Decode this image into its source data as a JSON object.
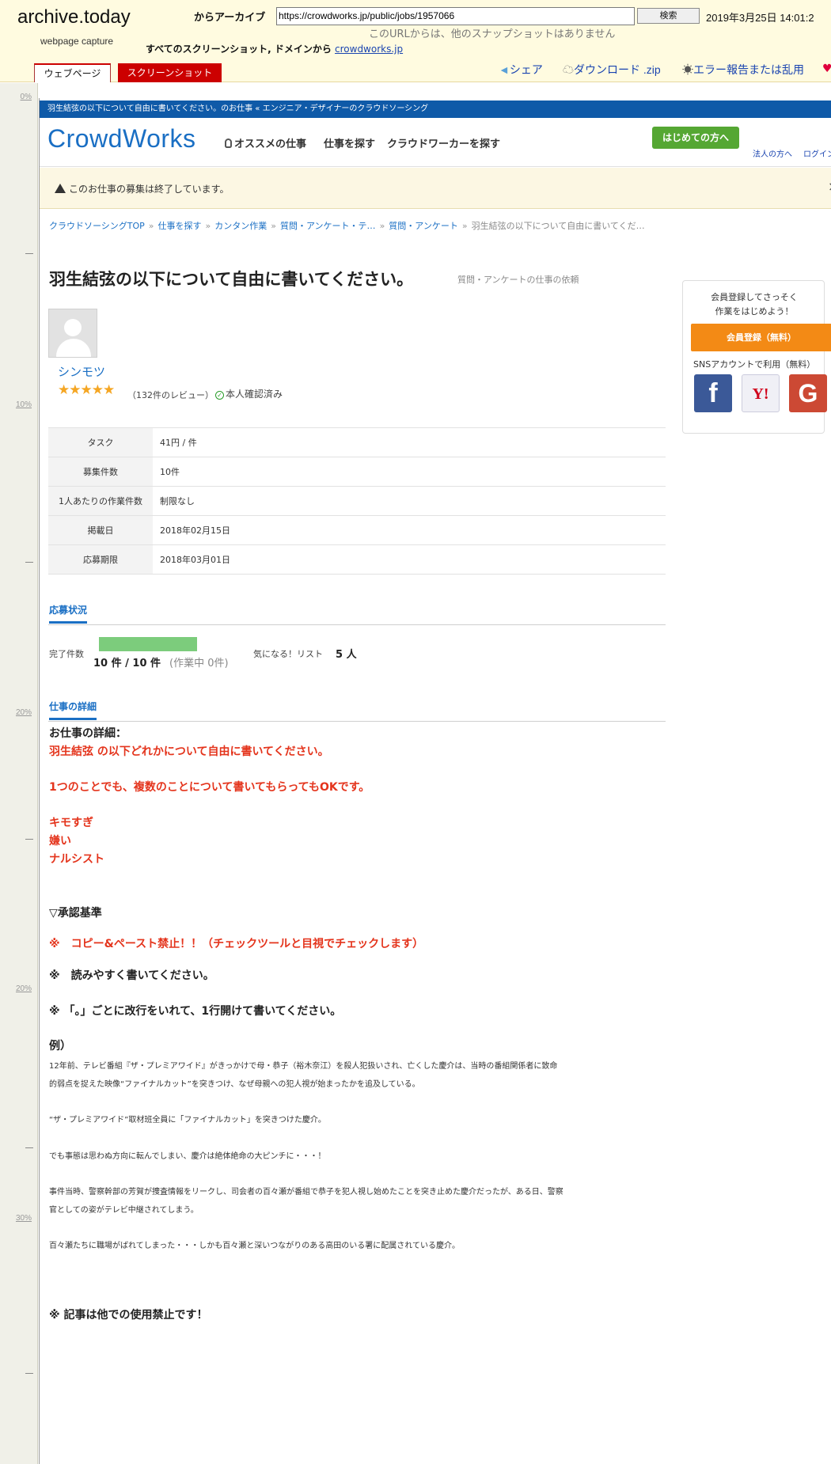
{
  "archive": {
    "logo": "archive.today",
    "subtitle": "webpage capture",
    "from_label": "からアーカイブ",
    "url": "https://crowdworks.jp/public/jobs/1957066",
    "search_button": "検索",
    "date": "2019年3月25日 14:01:2",
    "no_snapshot_text": "このURLからは、他のスナップショットはありません",
    "all_screenshots_text": "すべてのスクリーンショット, ドメインから",
    "domain_link": "crowdworks.jp",
    "tabs": {
      "webpage": "ウェブページ",
      "screenshot": "スクリーンショット"
    },
    "actions": {
      "share": "シェア",
      "download": "ダウンロード .zip",
      "report": "エラー報告または乱用"
    },
    "icons": {
      "share": "share-icon",
      "download": "cloud-download-icon",
      "report": "bug-icon",
      "heart": "heart-icon"
    }
  },
  "ruler": {
    "labels": [
      "0%",
      "10%",
      "20%",
      "20%",
      "30%"
    ]
  },
  "site": {
    "top_strip": "羽生結弦の以下について自由に書いてください。のお仕事 « エンジニア・デザイナーのクラウドソーシング",
    "logo": "CrowdWorks",
    "nav": {
      "recommend": "オススメの仕事",
      "find_job": "仕事を探す",
      "find_worker": "クラウドワーカーを探す",
      "beginners": "はじめての方へ",
      "corporate": "法人の方へ",
      "login": "ログイン"
    },
    "closed_notice": "このお仕事の募集は終了しています。",
    "breadcrumb": [
      "クラウドソーシングTOP",
      "仕事を探す",
      "カンタン作業",
      "質問・アンケート・テ…",
      "質問・アンケート",
      "羽生結弦の以下について自由に書いてくだ…"
    ],
    "breadcrumb_sep": "»",
    "brand_color": "#1a6fc4",
    "accent_red": "#e4341c"
  },
  "job": {
    "title": "羽生結弦の以下について自由に書いてください。",
    "category": "質問・アンケートの仕事の依頼",
    "client": {
      "name": "シンモツ",
      "stars": "★★★★★",
      "rating": 5,
      "reviews": "（132件のレビュー）",
      "verified": "本人確認済み"
    },
    "info_table": [
      {
        "label": "タスク",
        "value": "41円 / 件"
      },
      {
        "label": "募集件数",
        "value": "10件"
      },
      {
        "label": "1人あたりの作業件数",
        "value": "制限なし"
      },
      {
        "label": "掲載日",
        "value": "2018年02月15日"
      },
      {
        "label": "応募期限",
        "value": "2018年03月01日"
      }
    ],
    "status": {
      "section_title": "応募状況",
      "done_label": "完了件数",
      "progress_fraction": 1.0,
      "done_count": "10 件 / 10 件",
      "in_progress": "(作業中 0件)",
      "watch_label": "気になる！リスト",
      "watch_count": "5 人"
    },
    "detail": {
      "section_title": "仕事の詳細",
      "heading": "お仕事の詳細：",
      "line1": "羽生結弦 の以下どれかについて自由に書いてください。",
      "line2": "1つのことでも、複数のことについて書いてもらってもOKです。",
      "topic1": "キモすぎ",
      "topic2": "嫌い",
      "topic3": "ナルシスト",
      "criteria_heading": "▽承認基準",
      "rule1": "※　コピー&ペースト禁止！！（チェックツールと目視でチェックします）",
      "rule2": "※　読みやすく書いてください。",
      "rule3": "※ 「。」ごとに改行をいれて、1行開けて書いてください。",
      "example_heading": "例）",
      "ex1a": "12年前、テレビ番組『ザ・プレミアワイド』がきっかけで母・恭子（裕木奈江）を殺人犯扱いされ、亡くした慶介は、当時の番組関係者に致命",
      "ex1b": "的弱点を捉えた映像“ファイナルカット”を突きつけ、なぜ母親への犯人視が始まったかを追及している。",
      "ex2": "“ザ・プレミアワイド”取材班全員に「ファイナルカット」を突きつけた慶介。",
      "ex3": "でも事態は思わぬ方向に転んでしまい、慶介は絶体絶命の大ピンチに・・・！",
      "ex4a": "事件当時、警察幹部の芳賀が捜査情報をリークし、司会者の百々瀬が番組で恭子を犯人視し始めたことを突き止めた慶介だったが、ある日、警察",
      "ex4b": "官としての姿がテレビ中継されてしまう。",
      "ex5": "百々瀬たちに職場がばれてしまった・・・しかも百々瀬と深いつながりのある高田のいる署に配属されている慶介。",
      "footer_note": "※ 記事は他での使用禁止です！"
    }
  },
  "sidebar": {
    "msg1": "会員登録してさっそく",
    "msg2": "作業をはじめよう！",
    "register": "会員登録（無料）",
    "sns_label": "SNSアカウントで利用（無料）",
    "facebook": "f",
    "yahoo": "Y!",
    "google": "G"
  }
}
